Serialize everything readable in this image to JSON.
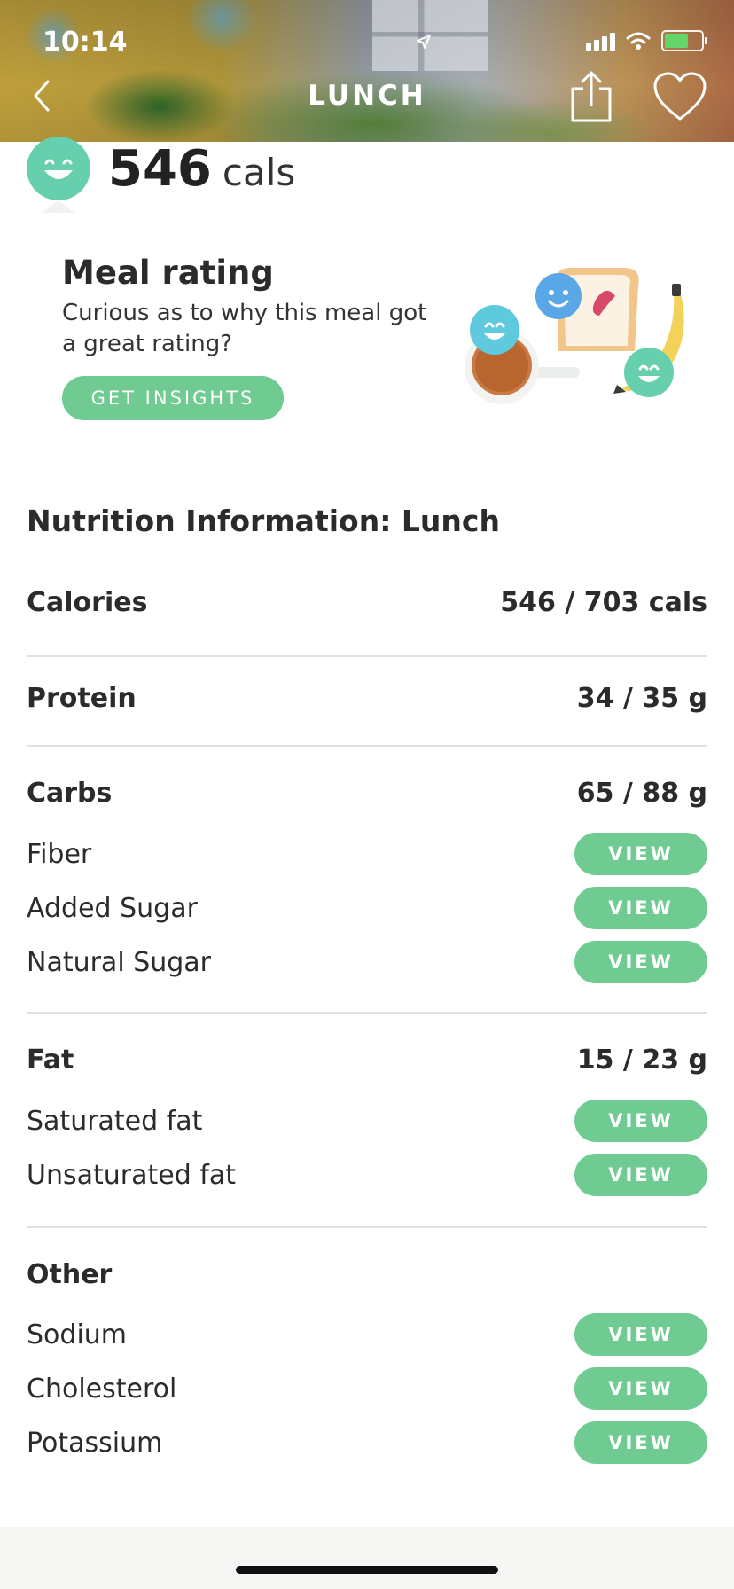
{
  "status_bar": {
    "time": "10:14"
  },
  "header": {
    "title": "LUNCH"
  },
  "summary": {
    "calories": "546",
    "unit": "cals"
  },
  "meal_rating": {
    "title": "Meal rating",
    "description": "Curious as to why this meal got a great rating?",
    "button_label": "GET INSIGHTS"
  },
  "nutrition": {
    "title": "Nutrition Information: Lunch",
    "view_label": "VIEW",
    "calories": {
      "label": "Calories",
      "value": "546 / 703 cals"
    },
    "protein": {
      "label": "Protein",
      "value": "34 / 35 g"
    },
    "carbs": {
      "label": "Carbs",
      "value": "65 / 88 g",
      "items": [
        {
          "label": "Fiber"
        },
        {
          "label": "Added Sugar"
        },
        {
          "label": "Natural Sugar"
        }
      ]
    },
    "fat": {
      "label": "Fat",
      "value": "15 / 23 g",
      "items": [
        {
          "label": "Saturated fat"
        },
        {
          "label": "Unsaturated fat"
        }
      ]
    },
    "other": {
      "label": "Other",
      "items": [
        {
          "label": "Sodium"
        },
        {
          "label": "Cholesterol"
        },
        {
          "label": "Potassium"
        }
      ]
    }
  },
  "colors": {
    "accent_green": "#6fcb91",
    "avatar_teal": "#66d0ae",
    "text": "#2b2b2b"
  }
}
